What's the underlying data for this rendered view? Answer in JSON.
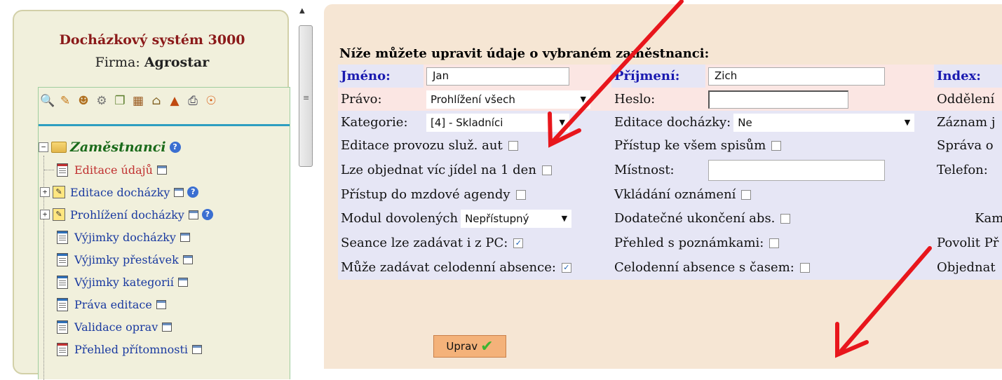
{
  "app": {
    "title": "Docházkový systém 3000",
    "firm_label": "Firma:",
    "firm_name": "Agrostar"
  },
  "toolbar": {
    "icons": [
      "search-icon",
      "pencil-icon",
      "users-icon",
      "key-icon",
      "copy-icon",
      "books-icon",
      "house-icon",
      "network-icon",
      "print-icon",
      "power-icon"
    ]
  },
  "tree": {
    "root_label": "Zaměstnanci",
    "items": [
      {
        "label": "Editace údajů",
        "expandable": false,
        "icon": "document-icon",
        "active": true
      },
      {
        "label": "Editace docházky",
        "expandable": true,
        "icon": "edit-icon",
        "help": true
      },
      {
        "label": "Prohlížení docházky",
        "expandable": true,
        "icon": "edit-icon",
        "help": true
      },
      {
        "label": "Výjimky docházky",
        "expandable": false,
        "icon": "document-icon"
      },
      {
        "label": "Výjimky přestávek",
        "expandable": false,
        "icon": "document-icon"
      },
      {
        "label": "Výjimky kategorií",
        "expandable": false,
        "icon": "document-icon"
      },
      {
        "label": "Práva editace",
        "expandable": false,
        "icon": "document-icon"
      },
      {
        "label": "Validace oprav",
        "expandable": false,
        "icon": "document-icon"
      },
      {
        "label": "Přehled přítomnosti",
        "expandable": false,
        "icon": "document-icon"
      }
    ]
  },
  "form": {
    "heading": "Níže můžete upravit údaje o vybraném zaměstnanci:",
    "jmeno_label": "Jméno:",
    "jmeno_value": "Jan",
    "prijmeni_label": "Příjmení:",
    "prijmeni_value": "Zich",
    "index_label": "Index:",
    "pravo_label": "Právo:",
    "pravo_value": "Prohlížení všech",
    "heslo_label": "Heslo:",
    "heslo_value": "",
    "oddeleni_label": "Oddělení",
    "kategorie_label": "Kategorie:",
    "kategorie_value": "[4] - Skladníci",
    "editace_dochazky_label": "Editace docházky:",
    "editace_dochazky_value": "Ne",
    "zaznam_label": "Záznam j",
    "editace_provozu_label": "Editace provozu služ. aut",
    "editace_provozu_checked": false,
    "pristup_spisum_label": "Přístup ke všem spisům",
    "pristup_spisum_checked": false,
    "sprava_label": "Správa o",
    "vice_jidel_label": "Lze objednat víc jídel na 1 den",
    "vice_jidel_checked": false,
    "mistnost_label": "Místnost:",
    "mistnost_value": "",
    "telefon_label": "Telefon:",
    "mzdove_label": "Přístup do mzdové agendy",
    "mzdove_checked": false,
    "vkladani_label": "Vkládání oznámení",
    "vkladani_checked": false,
    "modul_label": "Modul dovolených",
    "modul_value": "Nepřístupný",
    "dodatecne_label": "Dodatečné ukončení abs.",
    "dodatecne_checked": false,
    "kame_label": "Kame",
    "seance_label": "Seance lze zadávat i z PC:",
    "seance_checked": true,
    "prehled_pozn_label": "Přehled s poznámkami:",
    "prehled_pozn_checked": false,
    "povolit_label": "Povolit Př",
    "celodenni_label": "Může zadávat celodenní absence:",
    "celodenni_checked": true,
    "celodenni_cas_label": "Celodenní absence s časem:",
    "celodenni_cas_checked": false,
    "objednat_label": "Objednat",
    "submit_label": "Uprav"
  },
  "colors": {
    "title": "#8b1a1a",
    "label_blue": "#1a1ab0",
    "button": "#f4b27a",
    "arrow": "#e8161c"
  }
}
